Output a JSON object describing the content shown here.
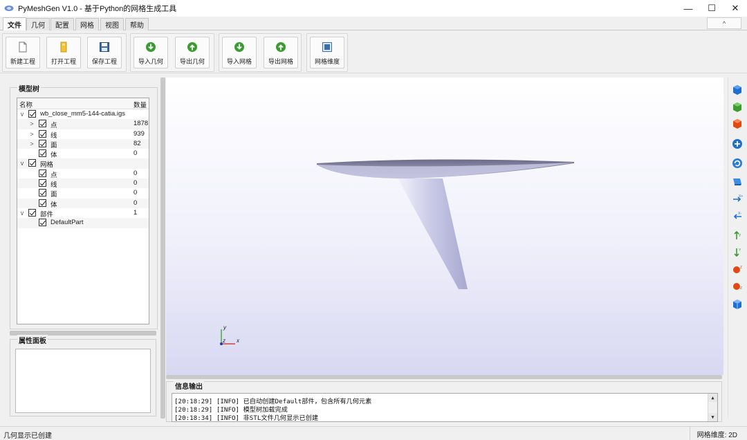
{
  "window": {
    "title": "PyMeshGen V1.0 - 基于Python的网格生成工具",
    "minimize": "—",
    "maximize": "☐",
    "close": "✕"
  },
  "tabs": [
    {
      "label": "文件",
      "active": true
    },
    {
      "label": "几何",
      "active": false
    },
    {
      "label": "配置",
      "active": false
    },
    {
      "label": "网格",
      "active": false
    },
    {
      "label": "视图",
      "active": false
    },
    {
      "label": "帮助",
      "active": false
    }
  ],
  "ribbon_collapse": "^",
  "ribbon": {
    "new_project": "新建工程",
    "open_project": "打开工程",
    "save_project": "保存工程",
    "import_geometry": "导入几何",
    "export_geometry": "导出几何",
    "import_mesh": "导入网格",
    "export_mesh": "导出网格",
    "mesh_dimension": "网格维度"
  },
  "model_tree": {
    "title": "模型树",
    "col_name": "名称",
    "col_count": "数量",
    "rows": [
      {
        "label": "wb_close_mm5-144-catia.igs",
        "count": "",
        "expander": "v"
      },
      {
        "label": "点",
        "count": "1878",
        "expander": ">"
      },
      {
        "label": "线",
        "count": "939",
        "expander": ">"
      },
      {
        "label": "面",
        "count": "82",
        "expander": ">"
      },
      {
        "label": "体",
        "count": "0",
        "expander": ""
      },
      {
        "label": "网格",
        "count": "",
        "expander": "v"
      },
      {
        "label": "点",
        "count": "0",
        "expander": ""
      },
      {
        "label": "线",
        "count": "0",
        "expander": ""
      },
      {
        "label": "面",
        "count": "0",
        "expander": ""
      },
      {
        "label": "体",
        "count": "0",
        "expander": ""
      },
      {
        "label": "部件",
        "count": "1",
        "expander": "v"
      },
      {
        "label": "DefaultPart",
        "count": "",
        "expander": ""
      }
    ]
  },
  "properties_panel": {
    "title": "属性面板"
  },
  "viewport": {
    "axis_y": "y",
    "axis_z": "z",
    "axis_x": "x"
  },
  "info_output": {
    "title": "信息输出",
    "lines": [
      "[20:18:29] [INFO] 已自动创建Default部件，包含所有几何元素",
      "[20:18:29] [INFO] 模型树加载完成",
      "[20:18:34] [INFO] 非STL文件几何显示已创建"
    ]
  },
  "status": {
    "message": "几何显示已创建",
    "mesh_dimension": "网格维度: 2D"
  },
  "colors": {
    "accent_blue": "#1f6fd1",
    "green": "#3a9b2e",
    "red": "#e04a12"
  }
}
